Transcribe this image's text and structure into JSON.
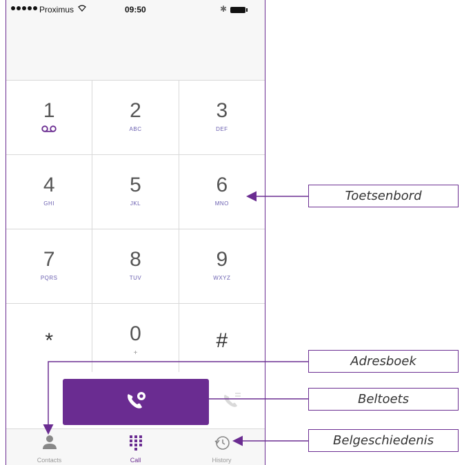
{
  "status_bar": {
    "carrier": "Proximus",
    "wifi_icon": "wifi-icon",
    "time": "09:50",
    "bluetooth_icon": "bluetooth-icon",
    "battery_icon": "battery-icon"
  },
  "keypad": {
    "rows": [
      [
        {
          "digit": "1",
          "sub": "voicemail-icon"
        },
        {
          "digit": "2",
          "sub": "ABC"
        },
        {
          "digit": "3",
          "sub": "DEF"
        }
      ],
      [
        {
          "digit": "4",
          "sub": "GHI"
        },
        {
          "digit": "5",
          "sub": "JKL"
        },
        {
          "digit": "6",
          "sub": "MNO"
        }
      ],
      [
        {
          "digit": "7",
          "sub": "PQRS"
        },
        {
          "digit": "8",
          "sub": "TUV"
        },
        {
          "digit": "9",
          "sub": "WXYZ"
        }
      ],
      [
        {
          "digit": "*",
          "sub": ""
        },
        {
          "digit": "0",
          "sub": "+"
        },
        {
          "digit": "#",
          "sub": ""
        }
      ]
    ]
  },
  "call": {
    "button_icon": "phone-call-icon",
    "side_icon": "phone-disabled-icon",
    "button_color": "#6a2c91"
  },
  "tabs": [
    {
      "label": "Contacts",
      "icon": "person-icon",
      "active": false
    },
    {
      "label": "Call",
      "icon": "dialpad-icon",
      "active": true
    },
    {
      "label": "History",
      "icon": "history-icon",
      "active": false
    }
  ],
  "annotations": {
    "keypad": "Toetsenbord",
    "contacts": "Adresboek",
    "call_button": "Beltoets",
    "history": "Belgeschiedenis"
  },
  "colors": {
    "accent": "#6a2c91",
    "subtext_blue": "#6a5fb0"
  }
}
